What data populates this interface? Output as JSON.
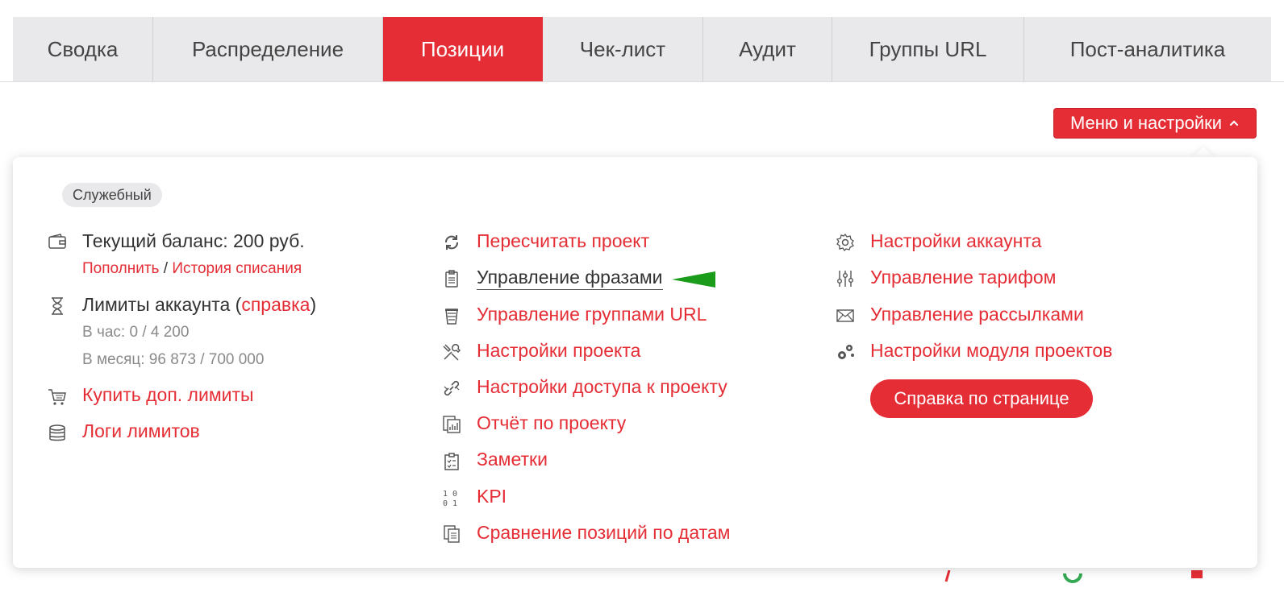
{
  "tabs": [
    {
      "label": "Сводка"
    },
    {
      "label": "Распределение"
    },
    {
      "label": "Позиции",
      "active": true
    },
    {
      "label": "Чек-лист"
    },
    {
      "label": "Аудит"
    },
    {
      "label": "Группы URL"
    },
    {
      "label": "Пост-аналитика"
    }
  ],
  "menu_button": {
    "label": "Меню и настройки",
    "icon": "chevron-up-icon"
  },
  "panel": {
    "badge": "Служебный",
    "col1": {
      "balance": {
        "text": "Текущий баланс: 200 руб.",
        "icon": "wallet-icon",
        "topup": "Пополнить",
        "sep": " / ",
        "history": "История списания"
      },
      "limits": {
        "text_before": "Лимиты аккаунта (",
        "link": "справка",
        "text_after": ")",
        "icon": "hourglass-icon",
        "per_hour": "В час: 0 / 4 200",
        "per_month": "В месяц: 96 873 / 700 000"
      },
      "buy": {
        "label": "Купить доп. лимиты",
        "icon": "cart-icon"
      },
      "logs": {
        "label": "Логи лимитов",
        "icon": "database-icon"
      }
    },
    "col2": [
      {
        "label": "Пересчитать проект",
        "icon": "refresh-icon"
      },
      {
        "label": "Управление фразами",
        "icon": "clipboard-list-icon",
        "highlighted": true
      },
      {
        "label": "Управление группами URL",
        "icon": "cup-icon"
      },
      {
        "label": "Настройки проекта",
        "icon": "tools-icon"
      },
      {
        "label": "Настройки доступа к проекту",
        "icon": "link-icon"
      },
      {
        "label": "Отчёт по проекту",
        "icon": "report-icon"
      },
      {
        "label": "Заметки",
        "icon": "checklist-icon"
      },
      {
        "label": "KPI",
        "icon": "binary-icon"
      },
      {
        "label": "Сравнение позиций по датам",
        "icon": "copy-icon"
      }
    ],
    "col3": [
      {
        "label": "Настройки аккаунта",
        "icon": "gear-icon"
      },
      {
        "label": "Управление тарифом",
        "icon": "sliders-icon"
      },
      {
        "label": "Управление рассылками",
        "icon": "envelope-icon"
      },
      {
        "label": "Настройки модуля проектов",
        "icon": "gears-icon"
      }
    ],
    "help_button": "Справка по странице"
  },
  "colors": {
    "accent": "#e52d35",
    "arrow": "#1a9b1a"
  }
}
